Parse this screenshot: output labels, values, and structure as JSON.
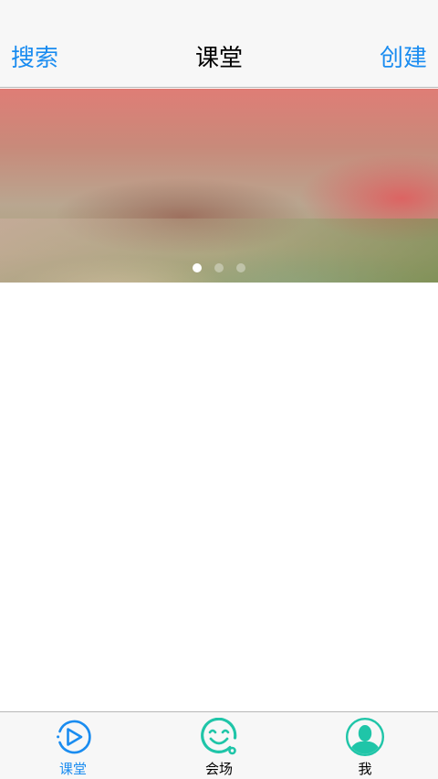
{
  "navbar": {
    "left_label": "搜索",
    "title": "课堂",
    "right_label": "创建"
  },
  "banner": {
    "page_count": 3,
    "active_page": 1
  },
  "tabbar": {
    "tabs": [
      {
        "label": "课堂",
        "icon": "play-circle-icon",
        "active": true
      },
      {
        "label": "会场",
        "icon": "smiley-icon",
        "active": false
      },
      {
        "label": "我",
        "icon": "profile-icon",
        "active": false
      }
    ]
  },
  "colors": {
    "accent": "#1a8cf0",
    "teal": "#1fc5a8",
    "bar_background": "#f7f7f7"
  }
}
